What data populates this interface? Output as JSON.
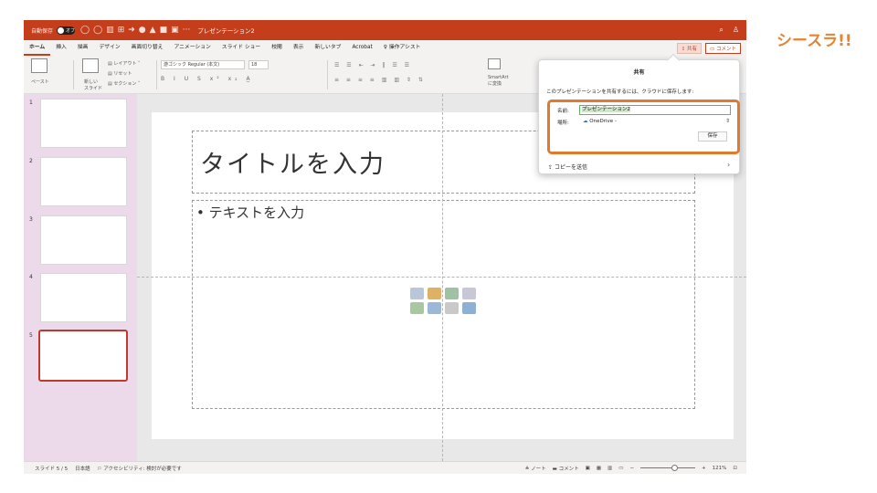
{
  "brand": {
    "logo_text": "シースラ!!"
  },
  "titlebar": {
    "autosave_label": "自動保存",
    "autosave_state": "オフ",
    "doc_title": "プレゼンテーション2",
    "bg_color": "#c43e1c"
  },
  "ribbon_tabs": [
    "ホーム",
    "挿入",
    "描画",
    "デザイン",
    "画面切り替え",
    "アニメーション",
    "スライド ショー",
    "校閲",
    "表示",
    "新しいタブ",
    "Acrobat",
    "操作アシスト"
  ],
  "share_button": "共有",
  "comment_button": "コメント",
  "ribbon": {
    "paste": "ペースト",
    "new_slide": "新しい\nスライド",
    "layout": "レイアウト",
    "reset": "リセット",
    "section": "セクション",
    "font": "游ゴシック Regular (本文)",
    "font_size": "18",
    "smartart": "SmartArt\nに変換"
  },
  "thumbnails": [
    {
      "number": "1"
    },
    {
      "number": "2"
    },
    {
      "number": "3"
    },
    {
      "number": "4"
    },
    {
      "number": "5"
    }
  ],
  "slide": {
    "title_placeholder": "タイトルを入力",
    "body_placeholder": "• テキストを入力"
  },
  "share_popover": {
    "title": "共有",
    "description": "このプレゼンテーションを共有するには、クラウドに保存します:",
    "name_label": "名前:",
    "name_value": "プレゼンテーション2",
    "location_label": "場所:",
    "location_value": "OneDrive -",
    "save_button": "保存",
    "send_copy": "コピーを送信",
    "highlight_color": "#e07a2e"
  },
  "statusbar": {
    "slide_count": "スライド 5 / 5",
    "language": "日本語",
    "accessibility": "アクセシビリティ: 検討が必要です",
    "notes": "ノート",
    "comments": "コメント",
    "zoom": "121%"
  }
}
